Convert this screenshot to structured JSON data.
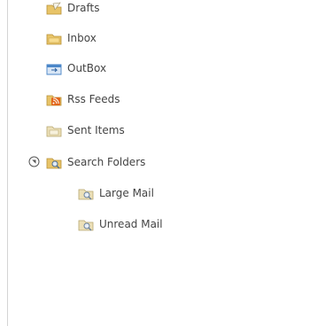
{
  "folders": [
    {
      "label": "Drafts",
      "icon": "drafts-folder-icon"
    },
    {
      "label": "Inbox",
      "icon": "inbox-folder-icon"
    },
    {
      "label": "OutBox",
      "icon": "outbox-folder-icon"
    },
    {
      "label": "Rss Feeds",
      "icon": "rss-folder-icon"
    },
    {
      "label": "Sent Items",
      "icon": "sent-items-folder-icon"
    },
    {
      "label": "Search Folders",
      "icon": "search-folder-icon",
      "expanded": true
    },
    {
      "label": "Large Mail",
      "icon": "search-folder-icon"
    },
    {
      "label": "Unread Mail",
      "icon": "search-folder-icon"
    }
  ],
  "colors": {
    "text": "#444444",
    "folder_yellow": "#e8c468",
    "outbox_blue": "#4a86c8",
    "rss_orange": "#e2661b",
    "border": "#d4d4d4"
  }
}
